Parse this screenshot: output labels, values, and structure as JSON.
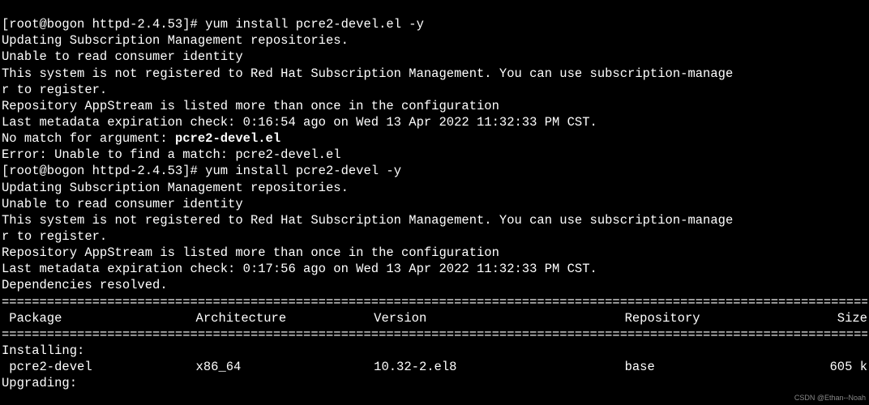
{
  "prompt1": "[root@bogon httpd-2.4.53]# ",
  "cmd1": "yum install pcre2-devel.el -y",
  "out1_l1": "Updating Subscription Management repositories.",
  "out1_l2": "Unable to read consumer identity",
  "out1_l3a": "This system is not registered to Red Hat Subscription Management. You can use subscription-manage",
  "out1_l3b": "r to register.",
  "out1_l4": "Repository AppStream is listed more than once in the configuration",
  "out1_l5": "Last metadata expiration check: 0:16:54 ago on Wed 13 Apr 2022 11:32:33 PM CST.",
  "out1_l6a": "No match for argument: ",
  "out1_l6b": "pcre2-devel.el",
  "out1_l7": "Error: Unable to find a match: pcre2-devel.el",
  "prompt2": "[root@bogon httpd-2.4.53]# ",
  "cmd2": "yum install pcre2-devel -y",
  "out2_l1": "Updating Subscription Management repositories.",
  "out2_l2": "Unable to read consumer identity",
  "out2_l3a": "This system is not registered to Red Hat Subscription Management. You can use subscription-manage",
  "out2_l3b": "r to register.",
  "out2_l4": "Repository AppStream is listed more than once in the configuration",
  "out2_l5": "Last metadata expiration check: 0:17:56 ago on Wed 13 Apr 2022 11:32:33 PM CST.",
  "out2_l6": "Dependencies resolved.",
  "rule": "========================================================================================================================",
  "hdr": {
    "pkg": " Package",
    "arch": "Architecture",
    "ver": "Version",
    "repo": "Repository",
    "size": "Size"
  },
  "sect_install": "Installing:",
  "row1": {
    "pkg": " pcre2-devel",
    "arch": "x86_64",
    "ver": "10.32-2.el8",
    "repo": "base",
    "size": "605 k"
  },
  "sect_upgrade": "Upgrading:",
  "watermark": "CSDN @Ethan--Noah"
}
